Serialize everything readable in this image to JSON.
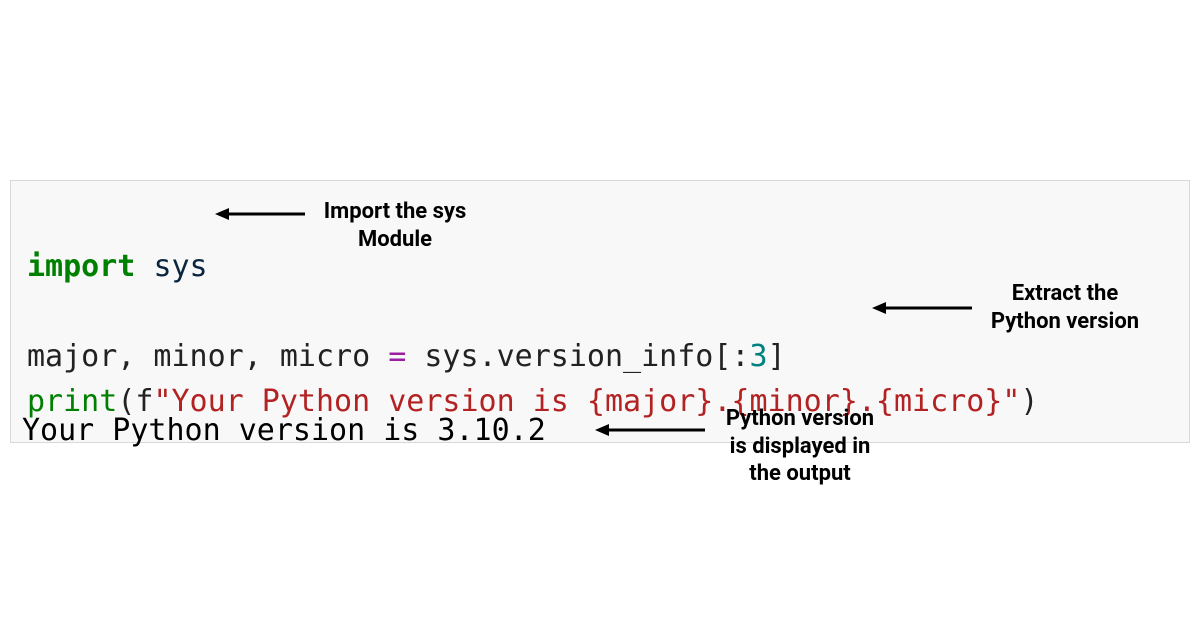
{
  "code": {
    "line1": {
      "keyword": "import",
      "module": "sys"
    },
    "line3": {
      "lhs": "major, minor, micro",
      "equals": "=",
      "rhs_expr_pre": "sys.version_info[:",
      "rhs_num": "3",
      "rhs_expr_post": "]"
    },
    "line4": {
      "func": "print",
      "open": "(f",
      "string": "\"Your Python version is {major}.{minor}.{micro}\"",
      "close": ")"
    }
  },
  "output": "Your Python version is 3.10.2",
  "annotations": {
    "a1_line1": "Import the sys",
    "a1_line2": "Module",
    "a2_line1": "Extract the",
    "a2_line2": "Python version",
    "a3_line1": "Python version",
    "a3_line2": "is displayed in",
    "a3_line3": "the output"
  }
}
